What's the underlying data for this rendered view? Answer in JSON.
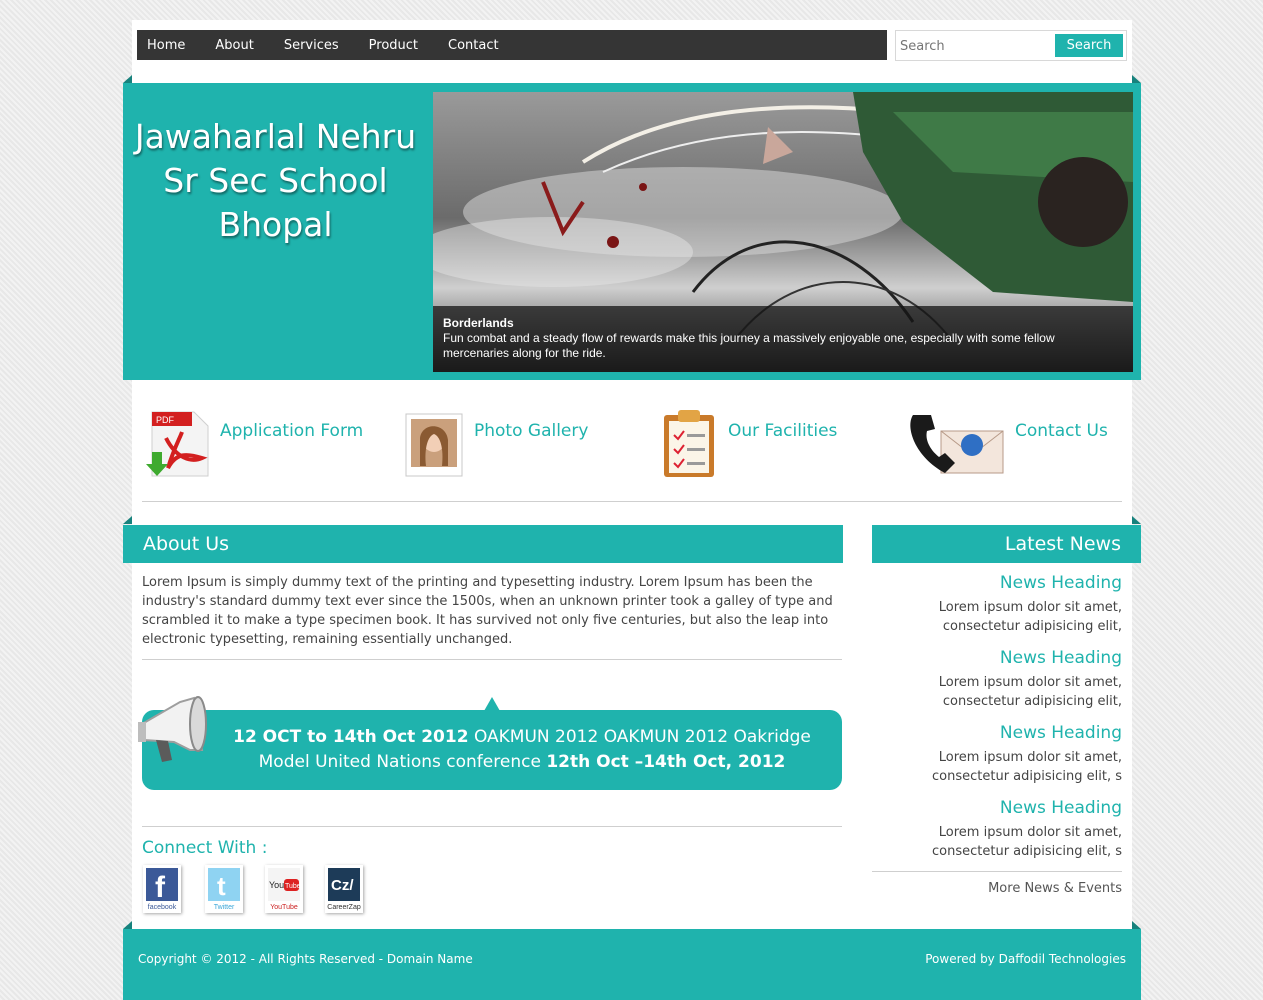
{
  "nav": {
    "items": [
      "Home",
      "About",
      "Services",
      "Product",
      "Contact"
    ]
  },
  "search": {
    "placeholder": "Search",
    "button": "Search"
  },
  "colors": {
    "accent": "#1fb3ad",
    "nav_bg": "#353535"
  },
  "banner": {
    "school_line1": "Jawaharlal Nehru",
    "school_line2": "Sr Sec School",
    "school_line3": "Bhopal",
    "slide_title": "Borderlands",
    "slide_text": "Fun combat and a steady flow of rewards make this journey a massively enjoyable one, especially with some fellow mercenaries along for the ride."
  },
  "quicklinks": [
    {
      "label": "Application Form",
      "icon": "pdf-download-icon"
    },
    {
      "label": "Photo Gallery",
      "icon": "photo-icon"
    },
    {
      "label": "Our Facilities",
      "icon": "clipboard-checklist-icon"
    },
    {
      "label": "Contact Us",
      "icon": "phone-mail-icon"
    }
  ],
  "about": {
    "heading": "About Us",
    "text": "Lorem Ipsum is simply dummy text of the printing and typesetting industry. Lorem Ipsum has been the industry's standard dummy text ever since the 1500s, when an unknown printer took a galley of type and scrambled it to make a type specimen book. It has survived not only five centuries, but also the leap into electronic typesetting, remaining essentially unchanged."
  },
  "announcement": {
    "bold1": "12 OCT to 14th Oct 2012",
    "text1": " OAKMUN 2012 OAKMUN 2012 Oakridge",
    "text2": "Model United Nations conference ",
    "bold2": "12th Oct –14th Oct, 2012"
  },
  "connect": {
    "heading": "Connect With :",
    "items": [
      {
        "label": "facebook",
        "icon": "facebook-icon"
      },
      {
        "label": "Twitter",
        "icon": "twitter-icon"
      },
      {
        "label": "YouTube",
        "icon": "youtube-icon"
      },
      {
        "label": "CareerZap",
        "icon": "careerzap-icon"
      }
    ]
  },
  "news": {
    "heading": "Latest News",
    "items": [
      {
        "title": "News Heading",
        "line1": "Lorem ipsum dolor sit amet,",
        "line2": "consectetur adipisicing elit,"
      },
      {
        "title": "News Heading",
        "line1": "Lorem ipsum dolor sit amet,",
        "line2": "consectetur adipisicing elit,"
      },
      {
        "title": "News Heading",
        "line1": "Lorem ipsum dolor sit amet,",
        "line2": "consectetur adipisicing elit, s"
      },
      {
        "title": "News Heading",
        "line1": "Lorem ipsum dolor sit amet,",
        "line2": "consectetur adipisicing elit, s"
      }
    ],
    "more": "More News & Events"
  },
  "footer": {
    "copyright": "Copyright © 2012 - All Rights Reserved - Domain Name",
    "powered": "Powered by Daffodil Technologies"
  }
}
